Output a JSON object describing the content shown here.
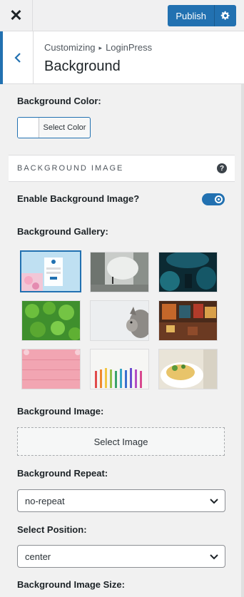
{
  "topbar": {
    "close_glyph": "✕",
    "publish_label": "Publish",
    "gear_icon": "gear-icon"
  },
  "header": {
    "crumb_root": "Customizing",
    "crumb_sep": "▸",
    "crumb_leaf": "LoginPress",
    "title": "Background"
  },
  "background_color": {
    "label": "Background Color:",
    "button_label": "Select Color"
  },
  "background_image_section": {
    "title": "Background Image",
    "help_glyph": "?"
  },
  "enable_image": {
    "label": "Enable Background Image?",
    "enabled": true
  },
  "gallery": {
    "label": "Background Gallery:",
    "selected_index": 0
  },
  "background_image": {
    "label": "Background Image:",
    "button_label": "Select Image"
  },
  "background_repeat": {
    "label": "Background Repeat:",
    "value": "no-repeat"
  },
  "select_position": {
    "label": "Select Position:",
    "value": "center"
  },
  "image_size": {
    "label": "Background Image Size:"
  },
  "colors": {
    "accent": "#2271b1",
    "panel": "#f1f1f1"
  }
}
